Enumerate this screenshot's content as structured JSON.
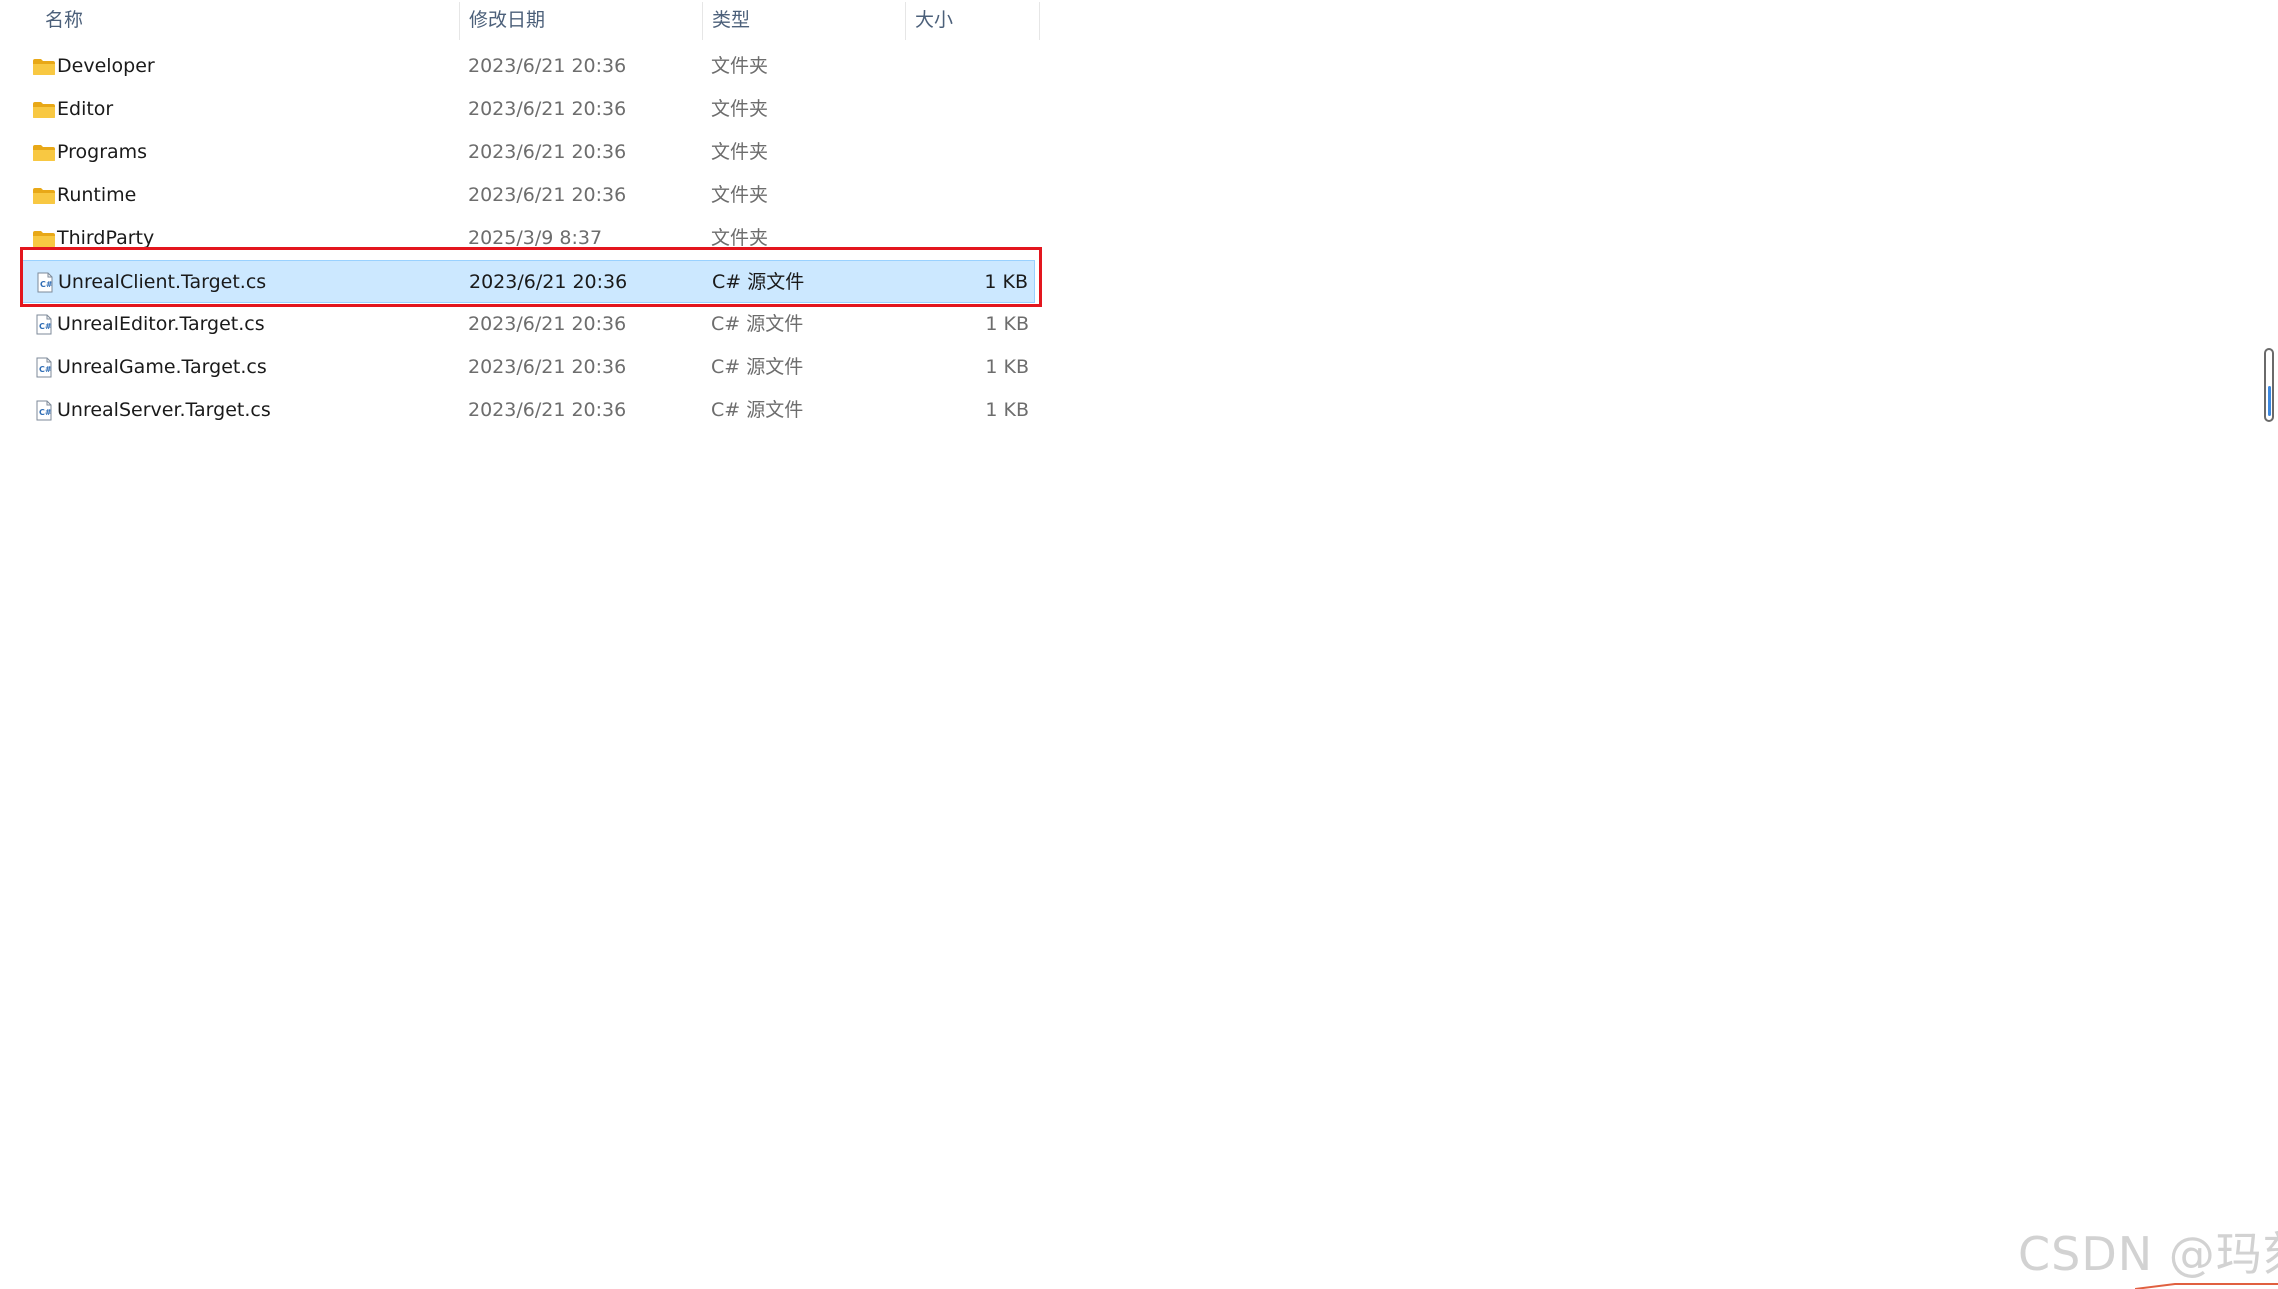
{
  "columns": {
    "name": "名称",
    "date": "修改日期",
    "type": "类型",
    "size": "大小"
  },
  "sort_indicator": "^",
  "files": [
    {
      "name": "Developer",
      "date": "2023/6/21 20:36",
      "type": "文件夹",
      "size": "",
      "icon": "folder-icon",
      "selected": false
    },
    {
      "name": "Editor",
      "date": "2023/6/21 20:36",
      "type": "文件夹",
      "size": "",
      "icon": "folder-icon",
      "selected": false
    },
    {
      "name": "Programs",
      "date": "2023/6/21 20:36",
      "type": "文件夹",
      "size": "",
      "icon": "folder-icon",
      "selected": false
    },
    {
      "name": "Runtime",
      "date": "2023/6/21 20:36",
      "type": "文件夹",
      "size": "",
      "icon": "folder-icon",
      "selected": false
    },
    {
      "name": "ThirdParty",
      "date": "2025/3/9 8:37",
      "type": "文件夹",
      "size": "",
      "icon": "folder-icon",
      "selected": false
    },
    {
      "name": "UnrealClient.Target.cs",
      "date": "2023/6/21 20:36",
      "type": "C# 源文件",
      "size": "1 KB",
      "icon": "csharp-file-icon",
      "selected": true
    },
    {
      "name": "UnrealEditor.Target.cs",
      "date": "2023/6/21 20:36",
      "type": "C# 源文件",
      "size": "1 KB",
      "icon": "csharp-file-icon",
      "selected": false
    },
    {
      "name": "UnrealGame.Target.cs",
      "date": "2023/6/21 20:36",
      "type": "C# 源文件",
      "size": "1 KB",
      "icon": "csharp-file-icon",
      "selected": false
    },
    {
      "name": "UnrealServer.Target.cs",
      "date": "2023/6/21 20:36",
      "type": "C# 源文件",
      "size": "1 KB",
      "icon": "csharp-file-icon",
      "selected": false
    }
  ],
  "colors": {
    "selection_bg": "#cce8ff",
    "selection_border": "#99d1ff",
    "highlight_box": "#e3161e",
    "folder": "#f8c842",
    "header_text": "#4c607a"
  },
  "watermark": "CSDN @玛刻"
}
